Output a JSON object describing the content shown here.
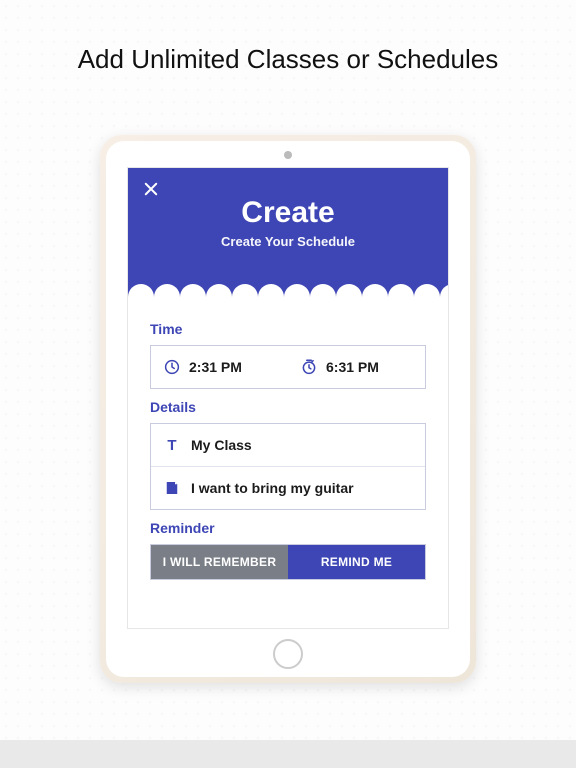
{
  "headline": "Add Unlimited Classes or Schedules",
  "hero": {
    "title": "Create",
    "subtitle": "Create Your Schedule"
  },
  "sections": {
    "time_label": "Time",
    "details_label": "Details",
    "reminder_label": "Reminder"
  },
  "time": {
    "start": "2:31 PM",
    "end": "6:31 PM"
  },
  "details": {
    "title": "My Class",
    "note": "I want to bring my guitar"
  },
  "reminder": {
    "option_off": "I WILL REMEMBER",
    "option_on": "REMIND ME"
  },
  "colors": {
    "brand": "#3d46b4",
    "segment_off": "#7a7f87"
  }
}
